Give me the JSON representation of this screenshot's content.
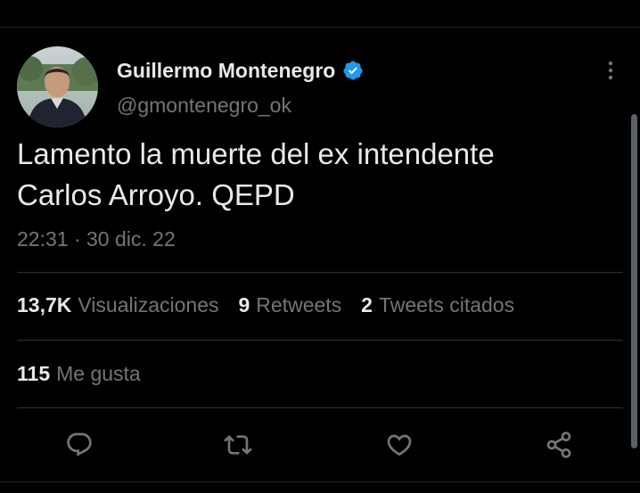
{
  "tweet": {
    "author_name": "Guillermo Montenegro",
    "handle": "@gmontenegro_ok",
    "text": "Lamento la muerte del ex intendente\nCarlos Arroyo. QEPD",
    "timestamp": "22:31 · 30 dic. 22"
  },
  "stats": {
    "views_count": "13,7K",
    "views_label": "Visualizaciones",
    "retweets_count": "9",
    "retweets_label": "Retweets",
    "quotes_count": "2",
    "quotes_label": "Tweets citados",
    "likes_count": "115",
    "likes_label": "Me gusta"
  },
  "icons": {
    "verified": "verified-badge-icon",
    "more": "more-options-icon",
    "reply": "reply-icon",
    "retweet": "retweet-icon",
    "like": "like-icon",
    "share": "share-icon"
  },
  "colors": {
    "background": "#000000",
    "text_primary": "#e7e9ea",
    "text_secondary": "#71767b",
    "verified_blue": "#1d9bf0",
    "divider": "#2f3336"
  }
}
